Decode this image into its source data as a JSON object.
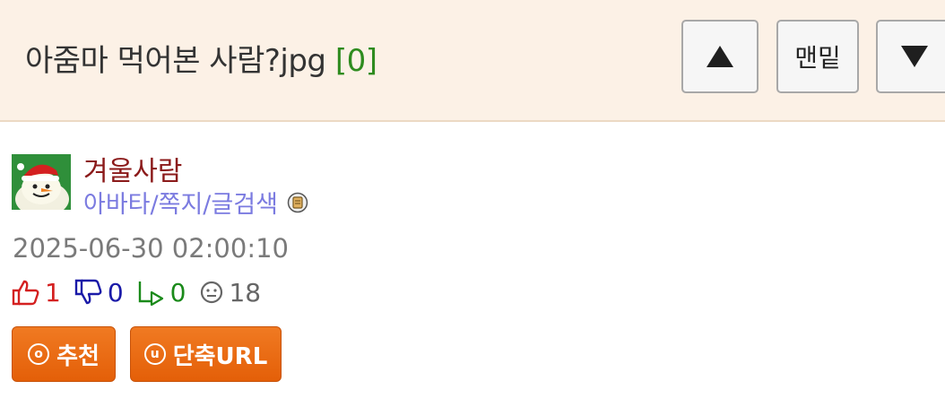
{
  "header": {
    "title": "아줌마 먹어본 사람?jpg",
    "comment_count": "[0]",
    "btn_bottom_label": "맨밑"
  },
  "icons": {
    "up": "triangle-up-icon",
    "down": "triangle-down-icon",
    "thumb_up": "thumbs-up-icon",
    "thumb_down": "thumbs-down-icon",
    "reply": "reply-arrow-icon",
    "views": "smiley-icon",
    "note": "note-icon",
    "recommend": "circle-o-icon",
    "shorturl": "circle-u-icon"
  },
  "author": {
    "name": "겨울사람",
    "links": "아바타/쪽지/글검색"
  },
  "post": {
    "datetime": "2025-06-30 02:00:10"
  },
  "stats": {
    "upvotes": "1",
    "downvotes": "0",
    "replies": "0",
    "views": "18"
  },
  "buttons": {
    "recommend_icon": "o",
    "recommend": "추천",
    "shorturl_icon": "u",
    "shorturl": "단축URL"
  },
  "colors": {
    "header_bg": "#fcf1e6",
    "button_orange": "#e96a12",
    "count_green": "#2e8b1e",
    "author_red": "#8b1a1a",
    "link_purple": "#7b7be0"
  }
}
